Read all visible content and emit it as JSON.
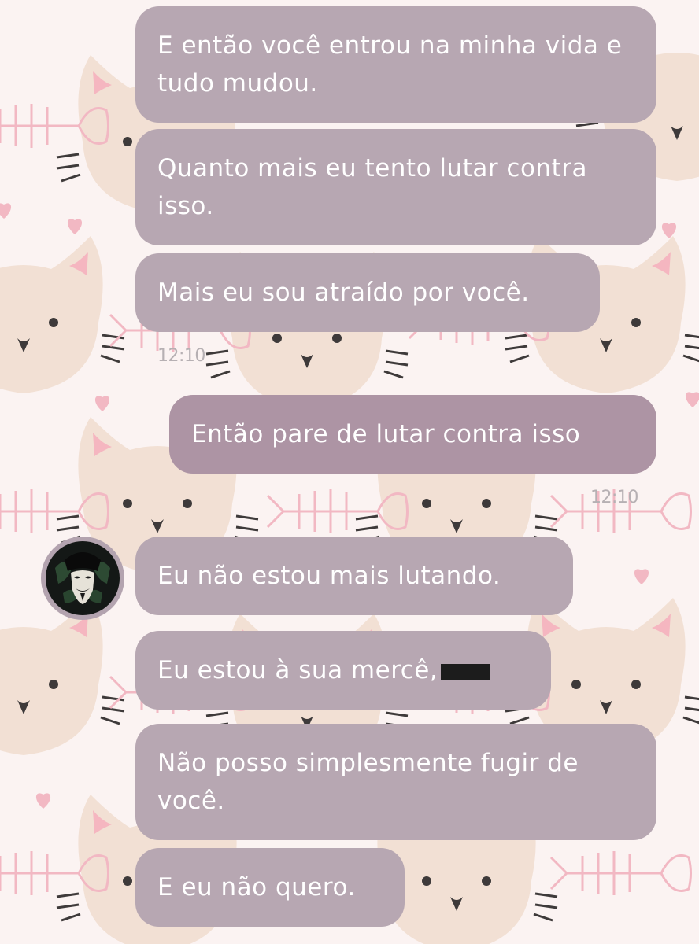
{
  "chat": {
    "messages": [
      {
        "direction": "received",
        "text": "E então você entrou na minha vida e tudo mudou."
      },
      {
        "direction": "received",
        "text": "Quanto mais eu tento lutar contra isso."
      },
      {
        "direction": "received",
        "text": "Mais eu sou atraído por você."
      },
      {
        "direction": "sent",
        "text": "Então pare de lutar contra isso"
      },
      {
        "direction": "received",
        "text": "Eu não estou mais lutando."
      },
      {
        "direction": "received",
        "text": "Eu estou à sua mercê,",
        "redacted_suffix": true
      },
      {
        "direction": "received",
        "text": "Não posso simplesmente fugir de você."
      },
      {
        "direction": "received",
        "text": "E eu não quero."
      }
    ],
    "timestamps": [
      "12:10",
      "12:10"
    ],
    "avatar_icon": "masked-avatar-icon"
  },
  "colors": {
    "background": "#fbf3f2",
    "received_bubble": "#b7a7b2",
    "sent_bubble": "#ad94a4",
    "bubble_text": "#ffffff",
    "timestamp": "#b6b0b3",
    "cat_face": "#f0dcd0",
    "heart": "#f2b8c3"
  }
}
